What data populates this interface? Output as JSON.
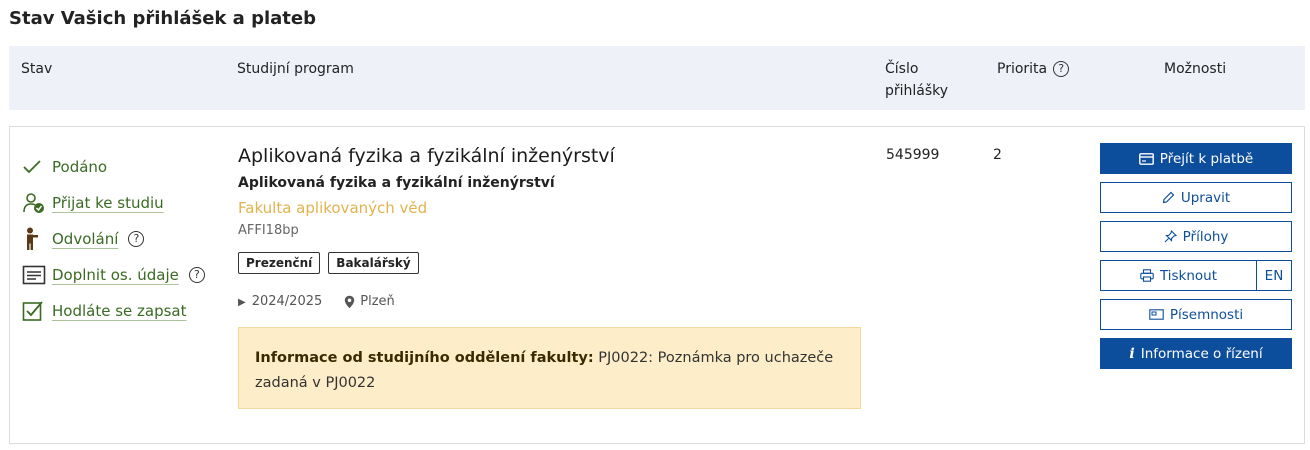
{
  "page": {
    "title": "Stav Vašich přihlášek a plateb"
  },
  "table": {
    "headers": {
      "stav": "Stav",
      "program": "Studijní program",
      "cislo": "Číslo přihlášky",
      "priorita": "Priorita",
      "moznosti": "Možnosti"
    }
  },
  "row": {
    "statuses": [
      {
        "label": "Podáno",
        "icon": "checkmark-icon"
      },
      {
        "label": "Přijat ke studiu",
        "icon": "user-check-icon"
      },
      {
        "label": "Odvolání",
        "icon": "person-standing-icon"
      },
      {
        "label": "Doplnit os. údaje",
        "icon": "form-card-icon"
      },
      {
        "label": "Hodláte se zapsat",
        "icon": "checkbox-checked-icon"
      }
    ],
    "program": {
      "title": "Aplikovaná fyzika a fyzikální inženýrství",
      "subtitle": "Aplikovaná fyzika a fyzikální inženýrství",
      "faculty": "Fakulta aplikovaných věd",
      "code": "AFFI18bp",
      "tags": [
        "Prezenční",
        "Bakalářský"
      ],
      "year": "2024/2025",
      "location": "Plzeň"
    },
    "info": {
      "label": "Informace od studijního oddělení fakulty:",
      "text": "PJ0022: Poznámka pro uchazeče zadaná v PJ0022"
    },
    "cislo": "545999",
    "priorita": "2",
    "actions": {
      "pay": "Přejít k platbě",
      "edit": "Upravit",
      "attachments": "Přílohy",
      "print": "Tisknout",
      "print_en": "EN",
      "documents": "Písemnosti",
      "info": "Informace o řízení"
    }
  },
  "colors": {
    "primary": "#0d4e9c",
    "status_green": "#3a6b23",
    "faculty": "#e2b34d",
    "info_bg": "#fdedc9"
  }
}
